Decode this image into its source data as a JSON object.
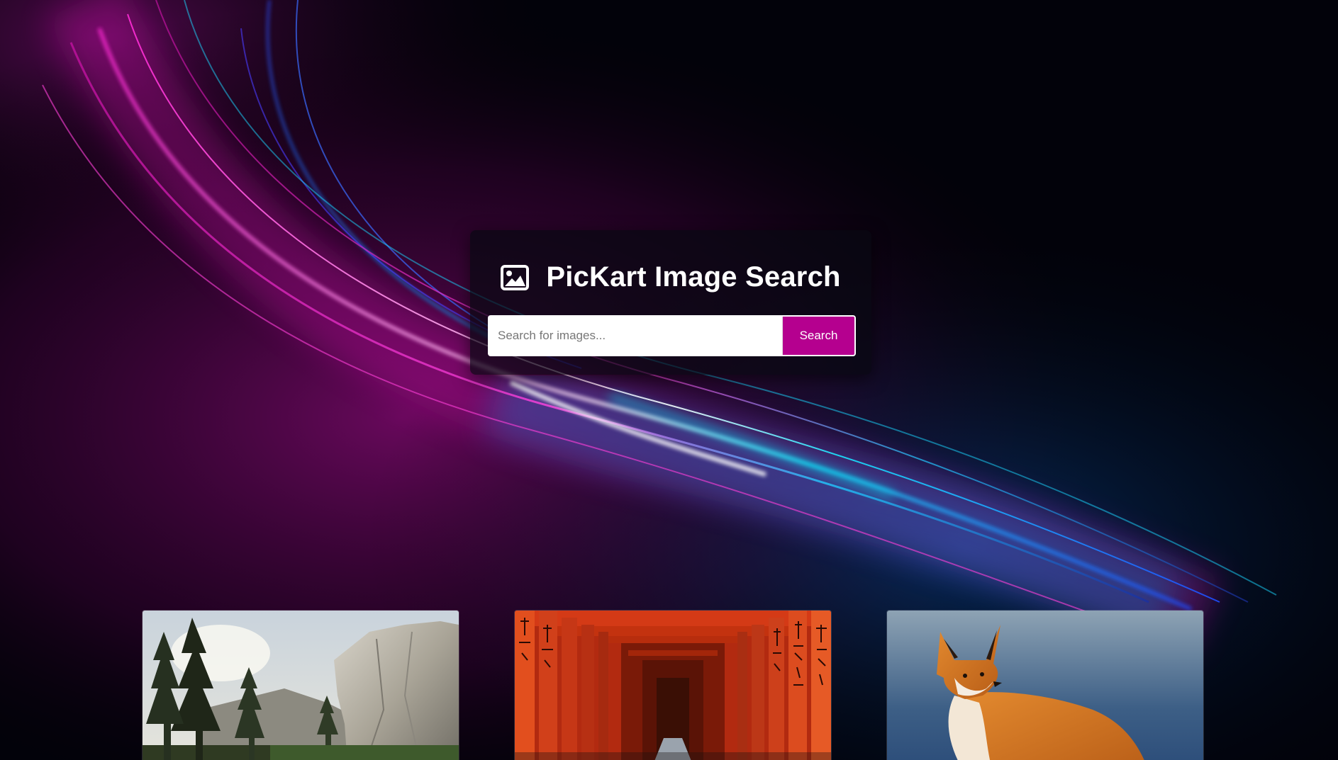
{
  "app": {
    "title": "PicKart Image Search"
  },
  "search": {
    "placeholder": "Search for images...",
    "value": "",
    "button_label": "Search"
  },
  "icons": {
    "title_icon": "image-icon"
  },
  "colors": {
    "accent": "#b5008f",
    "background": "#02020a",
    "title_text": "#ffffff"
  },
  "gallery": {
    "items": [
      {
        "subject": "forest-and-granite-cliff"
      },
      {
        "subject": "red-torii-gate-tunnel"
      },
      {
        "subject": "red-fox"
      }
    ]
  }
}
